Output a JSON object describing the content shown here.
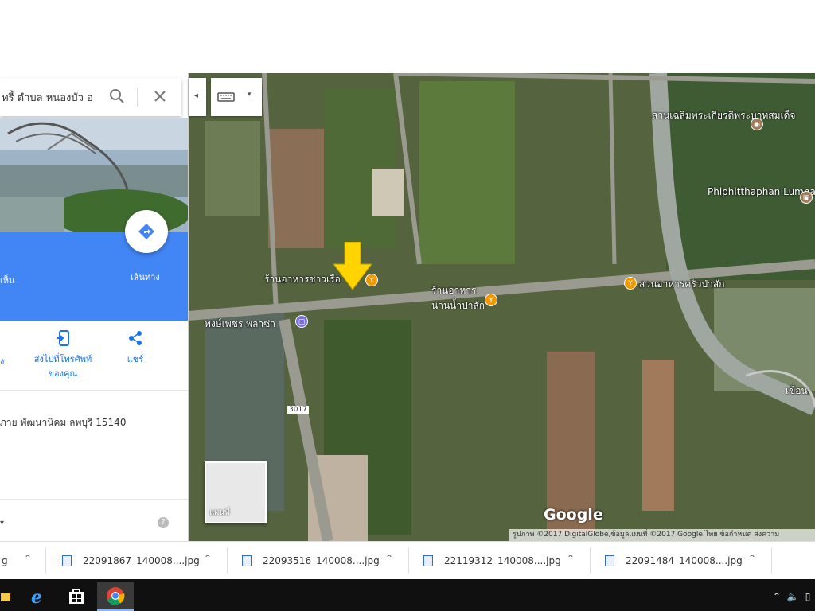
{
  "search": {
    "value": "ทรี้ ตำบล หนองบัว อ"
  },
  "place_panel": {
    "directions_label": "เส้นทาง",
    "left_blue_label": "เห็น",
    "actions": [
      {
        "label": "ง",
        "icon": "partial-icon"
      },
      {
        "label": "ส่งไปที่โทรศัพท์ของคุณ",
        "icon": "send-to-phone-icon"
      },
      {
        "label": "แชร์",
        "icon": "share-icon"
      }
    ],
    "address": "ภาย พัฒนานิคม ลพบุรี 15140"
  },
  "map": {
    "labels": {
      "park": "สวนเฉลิมพระเกียรติพระบาทสมเด็จ",
      "museum": "Phiphitthaphan Lumnam Pa Sak",
      "restaurant_1": "ร้านอาหารชาวเรือ",
      "restaurant_2": "ร้านอาหาร น่านน้ำป่าสัก",
      "restaurant_3": "สวนอาหารครัวป่าสัก",
      "shop": "พงษ์เพชร พลาซ่า",
      "dam": "เขื่อน",
      "road": "3017"
    },
    "thumbnail_label": "แผนที่",
    "google_logo": "Google",
    "attribution": "รูปภาพ ©2017 DigitalGlobe,ข้อมูลแผนที่ ©2017 Google   ไทย   ข้อกำหนด   ส่งความ"
  },
  "downloads": [
    {
      "name": "g"
    },
    {
      "name": "22091867_140008....jpg"
    },
    {
      "name": "22093516_140008....jpg"
    },
    {
      "name": "22119312_140008....jpg"
    },
    {
      "name": "22091484_140008....jpg"
    }
  ],
  "colors": {
    "blue_band": "#4285f4",
    "poi_food": "#f29900",
    "poi_shop": "#7b6fd6",
    "poi_camera": "#9e7b5a",
    "arrow_yellow": "#ffd400"
  }
}
